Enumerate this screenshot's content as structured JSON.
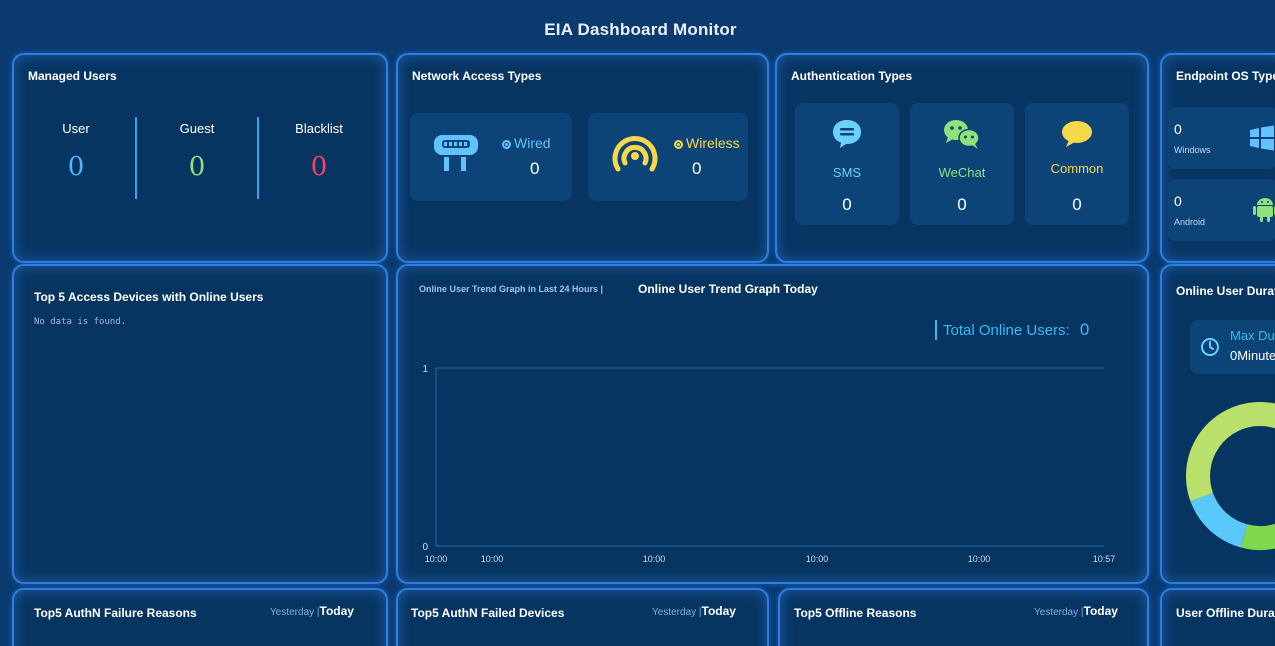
{
  "app_title": "EIA Dashboard Monitor",
  "managed_users": {
    "title": "Managed Users",
    "items": [
      {
        "label": "User",
        "value": "0",
        "color": "#4fb3ff"
      },
      {
        "label": "Guest",
        "value": "0",
        "color": "#8fe27a"
      },
      {
        "label": "Blacklist",
        "value": "0",
        "color": "#ff3d6a"
      }
    ]
  },
  "network_access": {
    "title": "Network Access Types",
    "wired": {
      "label": "Wired",
      "value": "0",
      "color": "#63c1ff",
      "icon": "wired-device-icon"
    },
    "wireless": {
      "label": "Wireless",
      "value": "0",
      "color": "#f7d84a",
      "icon": "wireless-signal-icon"
    }
  },
  "auth_types": {
    "title": "Authentication Types",
    "items": [
      {
        "label": "SMS",
        "value": "0",
        "color": "#6cd0ff",
        "icon": "sms-icon"
      },
      {
        "label": "WeChat",
        "value": "0",
        "color": "#8fe27a",
        "icon": "wechat-icon"
      },
      {
        "label": "Common",
        "value": "0",
        "color": "#f7d84a",
        "icon": "chat-bubble-icon"
      }
    ]
  },
  "endpoint_os": {
    "title": "Endpoint OS Type",
    "items": [
      {
        "name": "Windows",
        "value": "0",
        "icon": "windows-icon"
      },
      {
        "name": "Android",
        "value": "0",
        "icon": "android-icon"
      }
    ]
  },
  "top_access_devices": {
    "title": "Top 5 Access Devices with Online Users",
    "empty": "No data is found."
  },
  "trend": {
    "tab_inactive": "Online User Trend Graph in Last 24 Hours |",
    "tab_active": "Online User Trend Graph Today",
    "total_label": "Total Online Users:",
    "total_value": "0"
  },
  "duration": {
    "title": "Online User Durat",
    "max_label": "Max Du",
    "max_value": "0Minute"
  },
  "bottom": [
    {
      "title": "Top5 AuthN Failure Reasons",
      "yesterday": "Yesterday",
      "today": "Today"
    },
    {
      "title": "Top5 AuthN Failed Devices",
      "yesterday": "Yesterday",
      "today": "Today"
    },
    {
      "title": "Top5 Offline Reasons",
      "yesterday": "Yesterday",
      "today": "Today"
    },
    {
      "title": "User Offline Dura"
    }
  ],
  "chart_data": {
    "type": "line",
    "x": [
      "10:00",
      "10:00",
      "10:00",
      "10:00",
      "10:00",
      "10:57"
    ],
    "series": [],
    "ylim": [
      0,
      1
    ],
    "yticks": [
      "0",
      "1"
    ],
    "grid": true
  },
  "donut_data": {
    "type": "pie",
    "colors": [
      "#b8e06a",
      "#5ac8fa",
      "#7fd84e"
    ]
  }
}
